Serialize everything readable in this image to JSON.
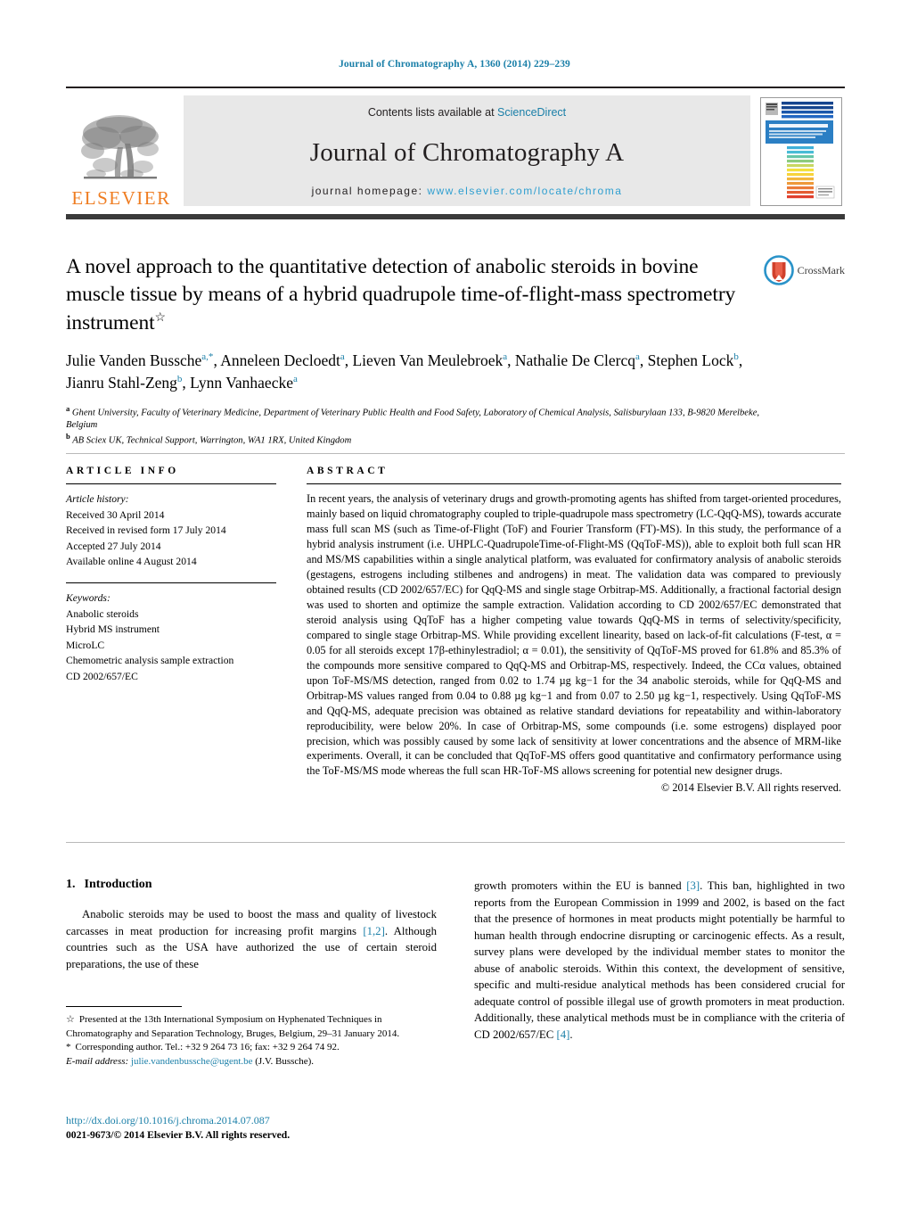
{
  "running_head": "Journal of Chromatography A, 1360 (2014) 229–239",
  "masthead": {
    "publisher_logo_text": "ELSEVIER",
    "contents_prefix": "Contents lists available at ",
    "contents_link": "ScienceDirect",
    "journal_title": "Journal of Chromatography A",
    "homepage_prefix": "journal homepage: ",
    "homepage_link": "www.elsevier.com/locate/chroma",
    "cover_title": "JOURNAL OF CHROMATOGRAPHY A",
    "cover_subtitle": "INCLUDING ELECTROPHORESIS AND OTHER SEPARATION METHODS"
  },
  "crossmark": {
    "label": "CrossMark"
  },
  "article": {
    "title": "A novel approach to the quantitative detection of anabolic steroids in bovine muscle tissue by means of a hybrid quadrupole time-of-flight-mass spectrometry instrument",
    "title_footnote_marker": "☆",
    "authors": [
      {
        "name": "Julie Vanden Bussche",
        "marks": "a,*"
      },
      {
        "name": "Anneleen Decloedt",
        "marks": "a"
      },
      {
        "name": "Lieven Van Meulebroek",
        "marks": "a"
      },
      {
        "name": "Nathalie De Clercq",
        "marks": "a"
      },
      {
        "name": "Stephen Lock",
        "marks": "b"
      },
      {
        "name": "Jianru Stahl-Zeng",
        "marks": "b"
      },
      {
        "name": "Lynn Vanhaecke",
        "marks": "a"
      }
    ],
    "affiliations": [
      {
        "mark": "a",
        "text": "Ghent University, Faculty of Veterinary Medicine, Department of Veterinary Public Health and Food Safety, Laboratory of Chemical Analysis, Salisburylaan 133, B-9820 Merelbeke, Belgium"
      },
      {
        "mark": "b",
        "text": "AB Sciex UK, Technical Support, Warrington, WA1 1RX, United Kingdom"
      }
    ]
  },
  "article_info": {
    "heading": "ARTICLE INFO",
    "history_label": "Article history:",
    "history": [
      "Received 30 April 2014",
      "Received in revised form 17 July 2014",
      "Accepted 27 July 2014",
      "Available online 4 August 2014"
    ],
    "keywords_label": "Keywords:",
    "keywords": [
      "Anabolic steroids",
      "Hybrid MS instrument",
      "MicroLC",
      "Chemometric analysis sample extraction",
      "CD 2002/657/EC"
    ]
  },
  "abstract": {
    "heading": "ABSTRACT",
    "text": "In recent years, the analysis of veterinary drugs and growth-promoting agents has shifted from target-oriented procedures, mainly based on liquid chromatography coupled to triple-quadrupole mass spectrometry (LC-QqQ-MS), towards accurate mass full scan MS (such as Time-of-Flight (ToF) and Fourier Transform (FT)-MS). In this study, the performance of a hybrid analysis instrument (i.e. UHPLC-QuadrupoleTime-of-Flight-MS (QqToF-MS)), able to exploit both full scan HR and MS/MS capabilities within a single analytical platform, was evaluated for confirmatory analysis of anabolic steroids (gestagens, estrogens including stilbenes and androgens) in meat. The validation data was compared to previously obtained results (CD 2002/657/EC) for QqQ-MS and single stage Orbitrap-MS. Additionally, a fractional factorial design was used to shorten and optimize the sample extraction. Validation according to CD 2002/657/EC demonstrated that steroid analysis using QqToF has a higher competing value towards QqQ-MS in terms of selectivity/specificity, compared to single stage Orbitrap-MS. While providing excellent linearity, based on lack-of-fit calculations (F-test, α = 0.05 for all steroids except 17β-ethinylestradiol; α = 0.01), the sensitivity of QqToF-MS proved for 61.8% and 85.3% of the compounds more sensitive compared to QqQ-MS and Orbitrap-MS, respectively. Indeed, the CCα values, obtained upon ToF-MS/MS detection, ranged from 0.02 to 1.74 µg kg−1 for the 34 anabolic steroids, while for QqQ-MS and Orbitrap-MS values ranged from 0.04 to 0.88 µg kg−1 and from 0.07 to 2.50 µg kg−1, respectively. Using QqToF-MS and QqQ-MS, adequate precision was obtained as relative standard deviations for repeatability and within-laboratory reproducibility, were below 20%. In case of Orbitrap-MS, some compounds (i.e. some estrogens) displayed poor precision, which was possibly caused by some lack of sensitivity at lower concentrations and the absence of MRM-like experiments. Overall, it can be concluded that QqToF-MS offers good quantitative and confirmatory performance using the ToF-MS/MS mode whereas the full scan HR-ToF-MS allows screening for potential new designer drugs.",
    "copyright": "© 2014 Elsevier B.V. All rights reserved."
  },
  "introduction": {
    "number": "1.",
    "heading": "Introduction",
    "col1_part1": "Anabolic steroids may be used to boost the mass and quality of livestock carcasses in meat production for increasing profit margins ",
    "col1_ref1": "[1,2]",
    "col1_part2": ". Although countries such as the USA have authorized the use of certain steroid preparations, the use of these",
    "col2_part1": "growth promoters within the EU is banned ",
    "col2_ref1": "[3]",
    "col2_part2": ". This ban, highlighted in two reports from the European Commission in 1999 and 2002, is based on the fact that the presence of hormones in meat products might potentially be harmful to human health through endocrine disrupting or carcinogenic effects. As a result, survey plans were developed by the individual member states to monitor the abuse of anabolic steroids. Within this context, the development of sensitive, specific and multi-residue analytical methods has been considered crucial for adequate control of possible illegal use of growth promoters in meat production. Additionally, these analytical methods must be in compliance with the criteria of CD 2002/657/EC ",
    "col2_ref2": "[4]",
    "col2_part3": "."
  },
  "footnotes": {
    "star_marker": "☆",
    "star_text": "Presented at the 13th International Symposium on Hyphenated Techniques in Chromatography and Separation Technology, Bruges, Belgium, 29–31 January 2014.",
    "corresponding_marker": "*",
    "corresponding_text": "Corresponding author. Tel.: +32 9 264 73 16; fax: +32 9 264 74 92.",
    "email_label": "E-mail address:",
    "email_link": "julie.vandenbussche@ugent.be",
    "email_suffix": "(J.V. Bussche)."
  },
  "footer": {
    "doi": "http://dx.doi.org/10.1016/j.chroma.2014.07.087",
    "issn": "0021-9673/© 2014 Elsevier B.V. All rights reserved."
  },
  "colors": {
    "link": "#1a7fa8",
    "homepage_link": "#2f9fd0",
    "elsevier_orange": "#ef7d22",
    "band_gray": "#e8e8e8",
    "rule_dark": "#3a3a3a"
  }
}
